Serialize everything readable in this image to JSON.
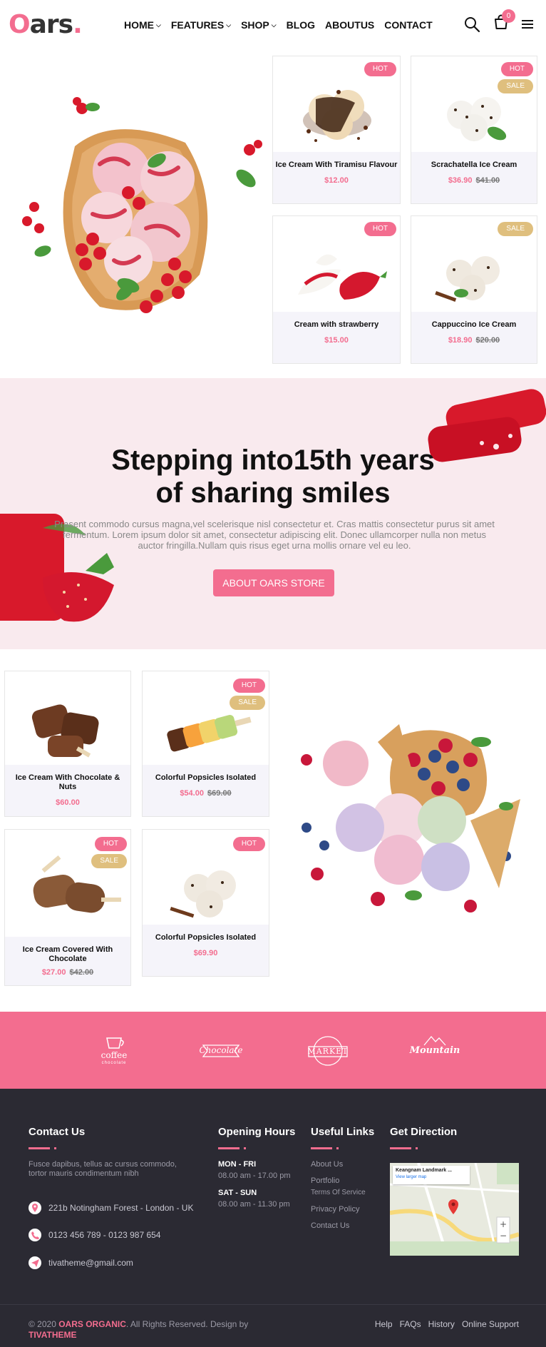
{
  "brand": {
    "logo_o": "O",
    "logo_rest": "ars",
    "logo_dot": "."
  },
  "nav": [
    {
      "label": "HOME",
      "dropdown": true
    },
    {
      "label": "FEATURES",
      "dropdown": true
    },
    {
      "label": "SHOP",
      "dropdown": true
    },
    {
      "label": "BLOG",
      "dropdown": false
    },
    {
      "label": "ABOUTUS",
      "dropdown": false
    },
    {
      "label": "CONTACT",
      "dropdown": false
    }
  ],
  "header_icons": {
    "search": "search-icon",
    "cart": "cart-icon",
    "cart_count": "0",
    "menu": "menu-icon"
  },
  "products_top": [
    {
      "name": "Ice Cream With Tiramisu Flavour",
      "price": "$12.00",
      "old_price": "",
      "badges": [
        "HOT"
      ]
    },
    {
      "name": "Scrachatella Ice Cream",
      "price": "$36.90",
      "old_price": "$41.00",
      "badges": [
        "HOT",
        "SALE"
      ]
    },
    {
      "name": "Cream with strawberry",
      "price": "$15.00",
      "old_price": "",
      "badges": [
        "HOT"
      ]
    },
    {
      "name": "Cappuccino Ice Cream",
      "price": "$18.90",
      "old_price": "$20.00",
      "badges": [
        "SALE"
      ]
    }
  ],
  "hero": {
    "title_line1": "Stepping into15th years",
    "title_line2": "of sharing smiles",
    "text": "Prasent commodo cursus magna,vel scelerisque nisl consectetur et. Cras mattis consectetur purus sit amet fermentum. Lorem ipsum dolor sit amet, consectetur adipiscing elit. Donec ullamcorper nulla non metus auctor fringilla.Nullam quis risus eget urna mollis ornare vel eu leo.",
    "cta": "ABOUT OARS STORE"
  },
  "products_bottom": [
    {
      "name": "Ice Cream With Chocolate & Nuts",
      "price": "$60.00",
      "old_price": "",
      "badges": []
    },
    {
      "name": "Colorful Popsicles Isolated",
      "price": "$54.00",
      "old_price": "$69.00",
      "badges": [
        "HOT",
        "SALE"
      ]
    },
    {
      "name": "Ice Cream Covered With Chocolate",
      "price": "$27.00",
      "old_price": "$42.00",
      "badges": [
        "HOT",
        "SALE"
      ]
    },
    {
      "name": "Colorful Popsicles Isolated",
      "price": "$69.90",
      "old_price": "",
      "badges": [
        "HOT"
      ]
    }
  ],
  "brands": [
    {
      "top": "",
      "main": "coffee",
      "sub": "chocolate"
    },
    {
      "top": "",
      "main": "Chocolate",
      "sub": ""
    },
    {
      "top": "",
      "main": "MARKET",
      "sub": ""
    },
    {
      "top": "",
      "main": "Mountain",
      "sub": ""
    }
  ],
  "footer": {
    "contact": {
      "title": "Contact Us",
      "text": "Fusce dapibus, tellus ac cursus commodo, tortor mauris condimentum nibh",
      "address": "221b Notingham Forest - London - UK",
      "phone": "0123 456 789 - 0123 987 654",
      "email": "tivatheme@gmail.com"
    },
    "hours": {
      "title": "Opening Hours",
      "rows": [
        {
          "day": "MON - FRI",
          "time": "08.00 am - 17.00 pm"
        },
        {
          "day": "SAT - SUN",
          "time": "08.00 am - 11.30 pm"
        }
      ]
    },
    "links": {
      "title": "Useful Links",
      "items": [
        "About Us",
        "Portfolio",
        "Terms Of Service",
        "Privacy Policy",
        "Contact Us"
      ]
    },
    "direction": {
      "title": "Get Direction",
      "map_place": "Keangnam Landmark ...",
      "map_link": "View larger map"
    }
  },
  "bottom": {
    "copy_prefix": "© 2020",
    "copy_brand": "OARS ORGANIC",
    "copy_mid": ". All Rights Reserved. Design by",
    "copy_designer": "TIVATHEME",
    "links": [
      "Help",
      "FAQs",
      "History",
      "Online Support"
    ]
  },
  "colors": {
    "accent": "#f36d8f",
    "sale": "#dfbf7e",
    "band_bg": "#f9eaee",
    "footer_bg": "#2b2a33"
  }
}
